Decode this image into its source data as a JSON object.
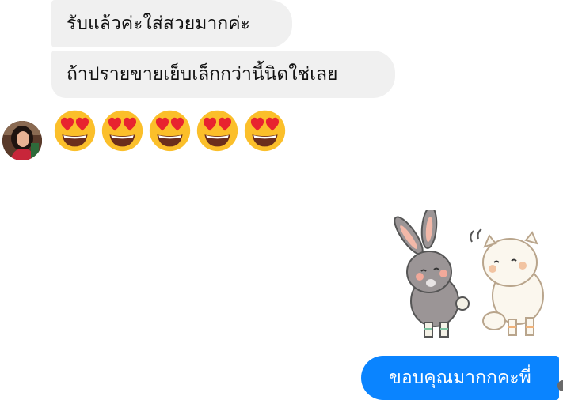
{
  "conversation": {
    "messages": [
      {
        "sender": "them",
        "text": "รับแล้วค่ะใส่สวยมากค่ะ"
      },
      {
        "sender": "them",
        "text": "ถ้าปรายขายเย็บเล็กกว่านี้นิดใช่เลย"
      },
      {
        "sender": "them",
        "emoji": "heart-eyes-face",
        "count": 5
      },
      {
        "sender": "me",
        "sticker": "bunny-and-cat-shy-sticker"
      },
      {
        "sender": "me",
        "text": "ขอบคุณมากกคะพี่"
      }
    ]
  },
  "colors": {
    "incoming_bubble": "#f0f0f0",
    "outgoing_bubble": "#0a84ff",
    "emoji_face": "#fbbf2a",
    "emoji_heart": "#e8232f"
  }
}
